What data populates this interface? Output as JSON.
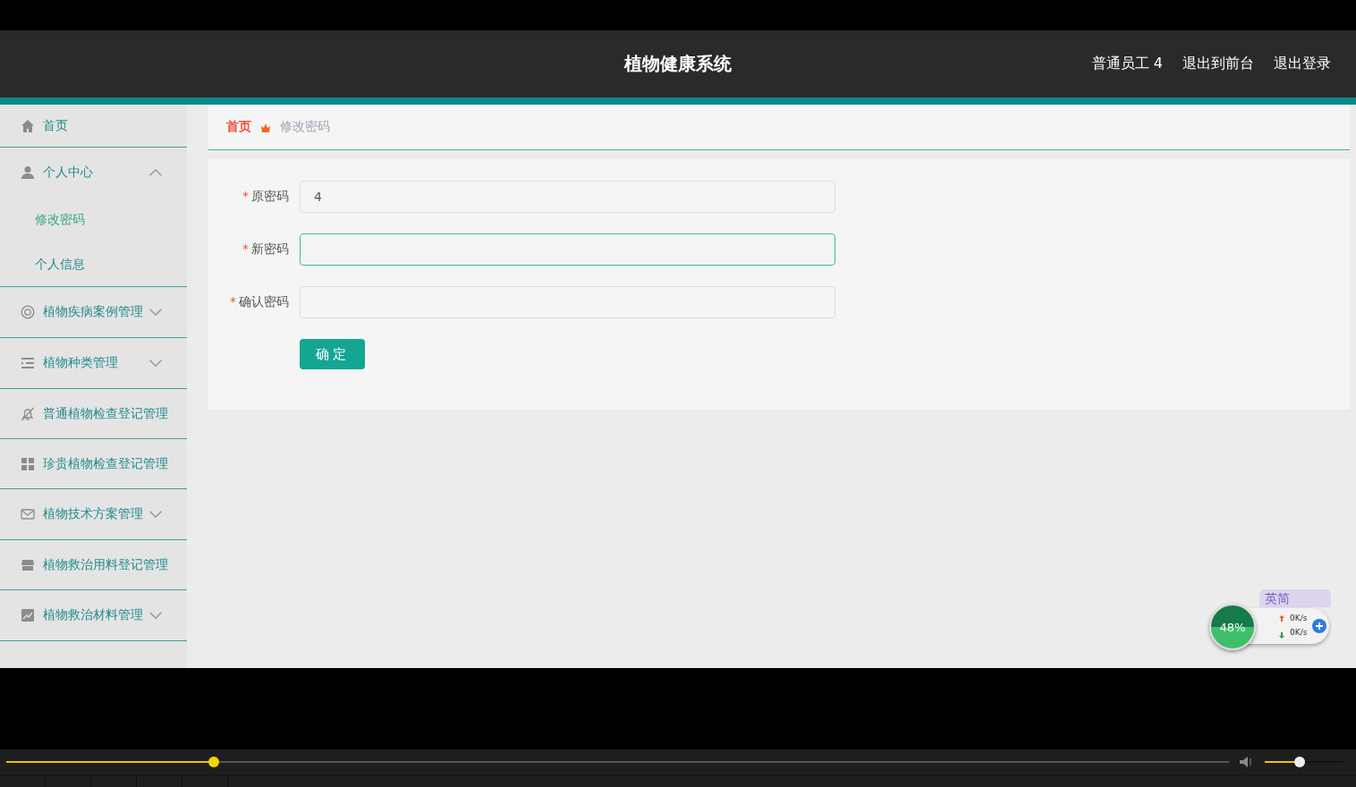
{
  "header": {
    "title": "植物健康系统",
    "links": [
      "普通员工 4",
      "退出到前台",
      "退出登录"
    ]
  },
  "sidebar": {
    "items": [
      {
        "kind": "link",
        "label": "首页"
      },
      {
        "kind": "group",
        "label": "个人中心",
        "expanded": true,
        "children": [
          {
            "label": "修改密码",
            "selected": true
          },
          {
            "label": "个人信息",
            "selected": false
          }
        ]
      },
      {
        "kind": "group",
        "label": "植物疾病案例管理",
        "expanded": false
      },
      {
        "kind": "group",
        "label": "植物种类管理",
        "expanded": false
      },
      {
        "kind": "link",
        "label": "普通植物检查登记管理"
      },
      {
        "kind": "link",
        "label": "珍贵植物检查登记管理"
      },
      {
        "kind": "group",
        "label": "植物技术方案管理",
        "expanded": false
      },
      {
        "kind": "link",
        "label": "植物救治用料登记管理"
      },
      {
        "kind": "group",
        "label": "植物救治材料管理",
        "expanded": false
      }
    ]
  },
  "breadcrumb": [
    {
      "label": "首页"
    },
    {
      "label": "修改密码"
    }
  ],
  "form": {
    "fields": [
      {
        "label": "原密码",
        "required_mark": "*",
        "value": "4",
        "focused": false
      },
      {
        "label": "新密码",
        "required_mark": "*",
        "focused": true
      },
      {
        "label": "确认密码",
        "required_mark": "*",
        "focused": false
      }
    ],
    "submit": "确定"
  },
  "widget": {
    "percent": "48%",
    "upload": "0K/s",
    "download": "0K/s",
    "ime": "英简"
  },
  "player": {
    "seek": {
      "level": 0.17
    },
    "volume": {
      "level": 0.44
    }
  }
}
